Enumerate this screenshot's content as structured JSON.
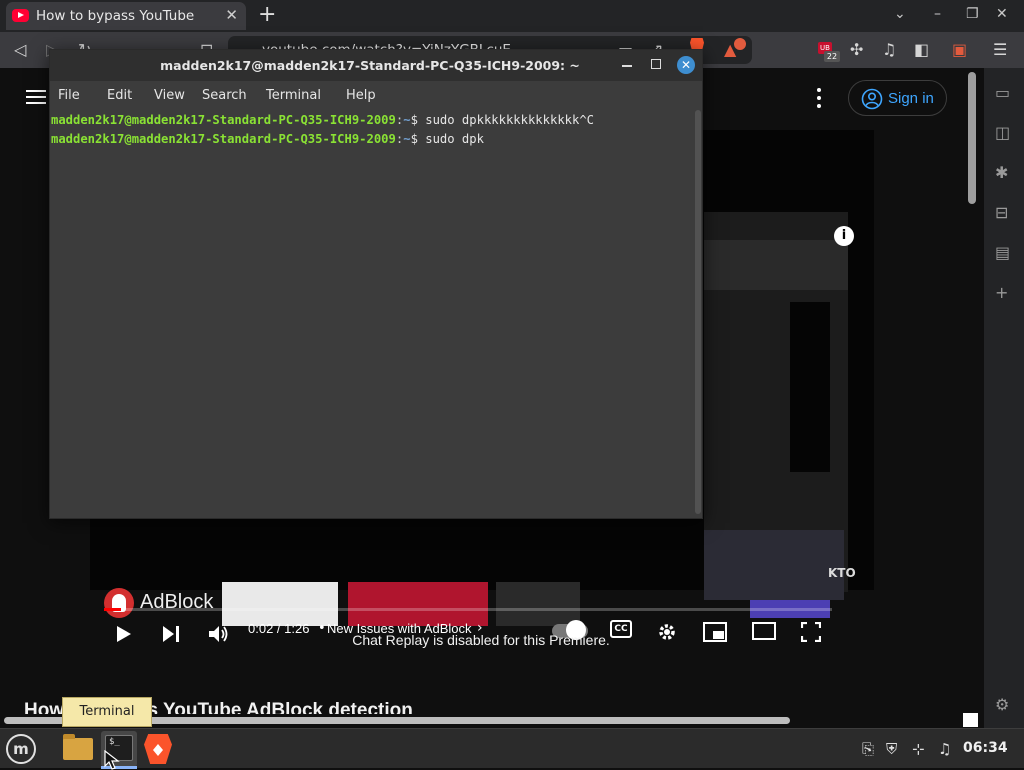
{
  "browser": {
    "tab": {
      "title": "How to bypass YouTube",
      "favicon_icon": "youtube-icon"
    },
    "url": "youtube.com/watch?v=YiNzYGBLcuE",
    "brave_badge_count": "22"
  },
  "youtube": {
    "sign_in": "Sign in",
    "player": {
      "time_current": "0:02",
      "time_total": "1:26",
      "time_display": "0:02 / 1:26",
      "chapter": "New Issues with AdBlock",
      "progress": 0.023,
      "overlay_brand": "AdBlock",
      "info_label": "i",
      "watermark_text": "KTO"
    },
    "chat_replay": "Chat Replay is disabled for this Premiere.",
    "video_title": "How to bypass YouTube AdBlock detection"
  },
  "terminal": {
    "title": "madden2k17@madden2k17-Standard-PC-Q35-ICH9-2009: ~",
    "menu": [
      "File",
      "Edit",
      "View",
      "Search",
      "Terminal",
      "Help"
    ],
    "lines": [
      {
        "user_host": "madden2k17@madden2k17-Standard-PC-Q35-ICH9-2009",
        "sep": ":",
        "path": "~",
        "symbol": "$",
        "command": " sudo dpkkkkkkkkkkkkkk^C"
      },
      {
        "user_host": "madden2k17@madden2k17-Standard-PC-Q35-ICH9-2009",
        "sep": ":",
        "path": "~",
        "symbol": "$",
        "command": " sudo dpk"
      }
    ]
  },
  "taskbar": {
    "tooltip": "Terminal",
    "clock": "06:34",
    "launcher_icon": "$_"
  }
}
